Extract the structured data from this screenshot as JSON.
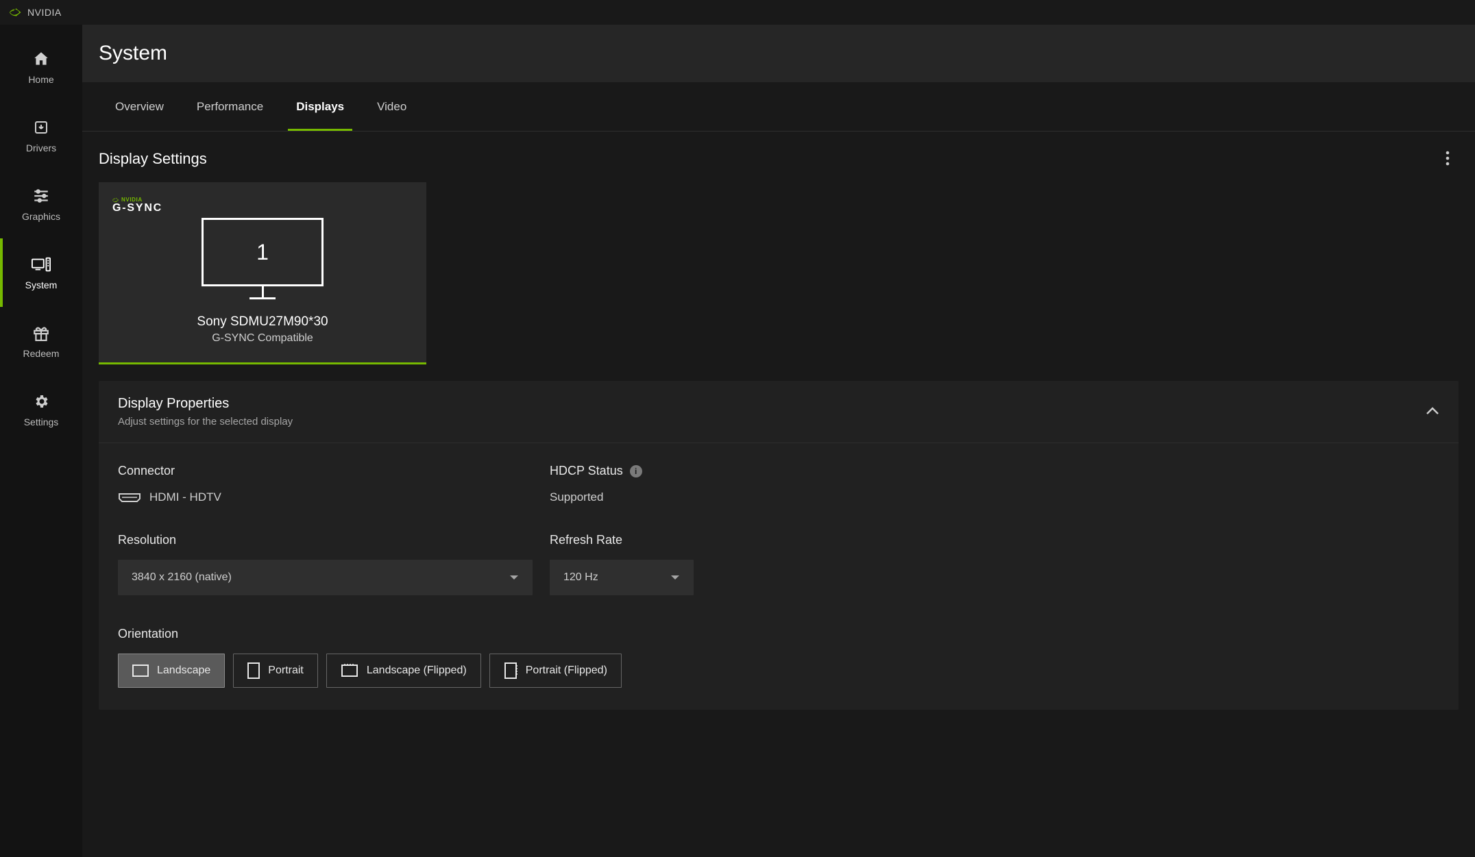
{
  "brand": "NVIDIA",
  "sidebar": {
    "items": [
      {
        "label": "Home"
      },
      {
        "label": "Drivers"
      },
      {
        "label": "Graphics"
      },
      {
        "label": "System"
      },
      {
        "label": "Redeem"
      },
      {
        "label": "Settings"
      }
    ]
  },
  "header": {
    "title": "System"
  },
  "tabs": {
    "items": [
      {
        "label": "Overview"
      },
      {
        "label": "Performance"
      },
      {
        "label": "Displays"
      },
      {
        "label": "Video"
      }
    ]
  },
  "displaySettings": {
    "title": "Display Settings",
    "monitor": {
      "gsync_brand": "NVIDIA",
      "gsync_label": "G-SYNC",
      "index": "1",
      "name": "Sony SDMU27M90*30",
      "sub": "G-SYNC Compatible"
    }
  },
  "properties": {
    "title": "Display Properties",
    "subtitle": "Adjust settings for the selected display",
    "connector": {
      "label": "Connector",
      "value": "HDMI - HDTV"
    },
    "hdcp": {
      "label": "HDCP Status",
      "value": "Supported"
    },
    "resolution": {
      "label": "Resolution",
      "value": "3840 x 2160 (native)"
    },
    "refresh": {
      "label": "Refresh Rate",
      "value": "120 Hz"
    },
    "orientation": {
      "label": "Orientation",
      "options": [
        "Landscape",
        "Portrait",
        "Landscape (Flipped)",
        "Portrait (Flipped)"
      ]
    }
  }
}
